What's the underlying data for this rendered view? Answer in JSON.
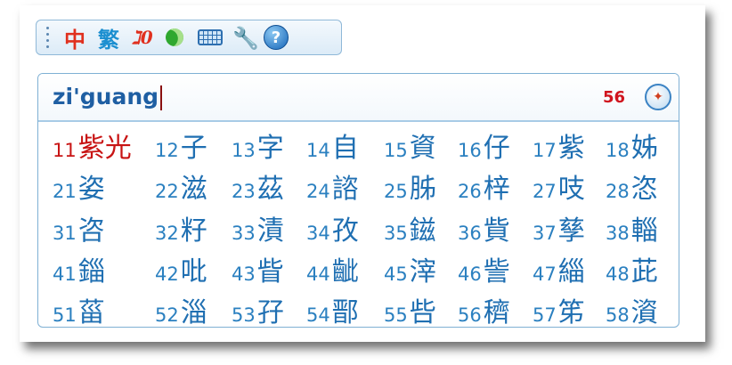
{
  "toolbar": {
    "buttons": [
      {
        "name": "chinese-mode",
        "label": "中"
      },
      {
        "name": "traditional",
        "label": "繁"
      },
      {
        "name": "full-width",
        "label": "ℷ0"
      },
      {
        "name": "punctuation-mode",
        "icon": "moon-icon"
      },
      {
        "name": "soft-keyboard",
        "icon": "keyboard-icon"
      },
      {
        "name": "settings",
        "icon": "wrench-icon"
      },
      {
        "name": "help",
        "label": "?"
      }
    ]
  },
  "composition": {
    "text": "zi'guang",
    "count": "56"
  },
  "candidates": [
    [
      {
        "n": "11",
        "c": "紫光"
      },
      {
        "n": "12",
        "c": "子"
      },
      {
        "n": "13",
        "c": "字"
      },
      {
        "n": "14",
        "c": "自"
      },
      {
        "n": "15",
        "c": "資"
      },
      {
        "n": "16",
        "c": "仔"
      },
      {
        "n": "17",
        "c": "紫"
      },
      {
        "n": "18",
        "c": "姊"
      }
    ],
    [
      {
        "n": "21",
        "c": "姿"
      },
      {
        "n": "22",
        "c": "滋"
      },
      {
        "n": "23",
        "c": "茲"
      },
      {
        "n": "24",
        "c": "諮"
      },
      {
        "n": "25",
        "c": "胏"
      },
      {
        "n": "26",
        "c": "梓"
      },
      {
        "n": "27",
        "c": "吱"
      },
      {
        "n": "28",
        "c": "恣"
      }
    ],
    [
      {
        "n": "31",
        "c": "咨"
      },
      {
        "n": "32",
        "c": "籽"
      },
      {
        "n": "33",
        "c": "漬"
      },
      {
        "n": "34",
        "c": "孜"
      },
      {
        "n": "35",
        "c": "鎡"
      },
      {
        "n": "36",
        "c": "貲"
      },
      {
        "n": "37",
        "c": "孳"
      },
      {
        "n": "38",
        "c": "輜"
      }
    ],
    [
      {
        "n": "41",
        "c": "錙"
      },
      {
        "n": "42",
        "c": "吡"
      },
      {
        "n": "43",
        "c": "眥"
      },
      {
        "n": "44",
        "c": "齜"
      },
      {
        "n": "45",
        "c": "滓"
      },
      {
        "n": "46",
        "c": "訾"
      },
      {
        "n": "47",
        "c": "緇"
      },
      {
        "n": "48",
        "c": "茈"
      }
    ],
    [
      {
        "n": "51",
        "c": "菑"
      },
      {
        "n": "52",
        "c": "淄"
      },
      {
        "n": "53",
        "c": "孖"
      },
      {
        "n": "54",
        "c": "鄑"
      },
      {
        "n": "55",
        "c": "呰"
      },
      {
        "n": "56",
        "c": "穧"
      },
      {
        "n": "57",
        "c": "笫"
      },
      {
        "n": "58",
        "c": "澬"
      }
    ]
  ],
  "selected": "11",
  "colors": {
    "accent": "#1f6fb2",
    "selected": "#c81414",
    "count": "#d0141e",
    "border": "#7fb0d4"
  }
}
